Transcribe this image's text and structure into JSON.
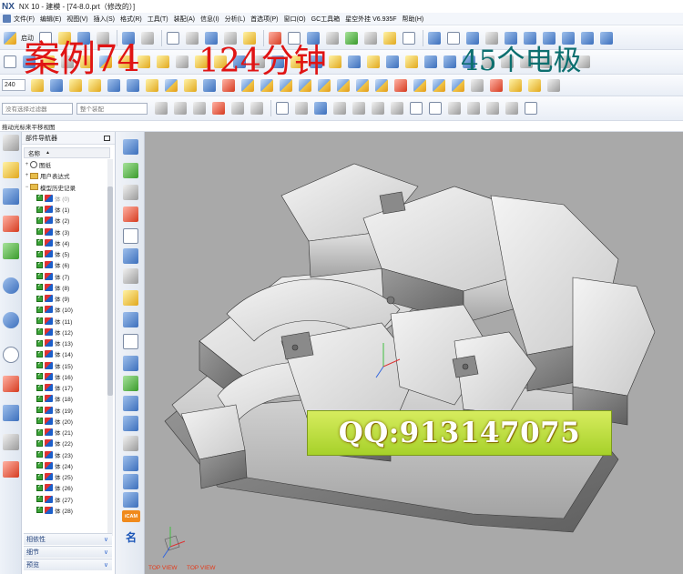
{
  "window": {
    "logo": "NX",
    "title": "NX 10 - 建模 - [74-8.0.prt（修改的）]"
  },
  "menu": {
    "items": [
      "文件(F)",
      "编辑(E)",
      "视图(V)",
      "插入(S)",
      "格式(R)",
      "工具(T)",
      "装配(A)",
      "信息(I)",
      "分析(L)",
      "首选项(P)",
      "窗口(O)",
      "GC工具箱",
      "星空外挂 V6.935F",
      "帮助(H)"
    ]
  },
  "toolbar": {
    "start_label": "启动",
    "zoom_value": "240",
    "filter_placeholder": "没有选择过滤器",
    "assembly_placeholder": "整个装配"
  },
  "overlay": {
    "case_title": "案例74",
    "duration": "124分钟",
    "electrodes": "45个电极",
    "contact": "QQ:913147075"
  },
  "status": {
    "hint": "拖动光标来平移视图"
  },
  "navigator": {
    "title": "部件导航器",
    "column_name": "名称",
    "sort_glyph": "▲",
    "tree": {
      "drawings": "图纸",
      "user_expressions": "用户表达式",
      "history": "模型历史记录"
    },
    "bodies": [
      {
        "label": "体 (0)",
        "dim": true
      },
      {
        "label": "体 (1)"
      },
      {
        "label": "体 (2)"
      },
      {
        "label": "体 (3)"
      },
      {
        "label": "体 (4)"
      },
      {
        "label": "体 (5)"
      },
      {
        "label": "体 (6)"
      },
      {
        "label": "体 (7)"
      },
      {
        "label": "体 (8)"
      },
      {
        "label": "体 (9)"
      },
      {
        "label": "体 (10)"
      },
      {
        "label": "体 (11)"
      },
      {
        "label": "体 (12)"
      },
      {
        "label": "体 (13)"
      },
      {
        "label": "体 (14)"
      },
      {
        "label": "体 (15)"
      },
      {
        "label": "体 (16)"
      },
      {
        "label": "体 (17)"
      },
      {
        "label": "体 (18)"
      },
      {
        "label": "体 (19)"
      },
      {
        "label": "体 (20)"
      },
      {
        "label": "体 (21)"
      },
      {
        "label": "体 (22)"
      },
      {
        "label": "体 (23)"
      },
      {
        "label": "体 (24)"
      },
      {
        "label": "体 (25)"
      },
      {
        "label": "体 (26)"
      },
      {
        "label": "体 (27)"
      },
      {
        "label": "体 (28)"
      }
    ],
    "sections": [
      "相依性",
      "细节",
      "预览"
    ]
  },
  "selection_bar": {
    "icam_label": "iCAM",
    "name_label": "名"
  },
  "graphics": {
    "view_label_left": "TOP VIEW",
    "view_label_right": "TOP VIEW",
    "background": "#a9a9a9"
  }
}
